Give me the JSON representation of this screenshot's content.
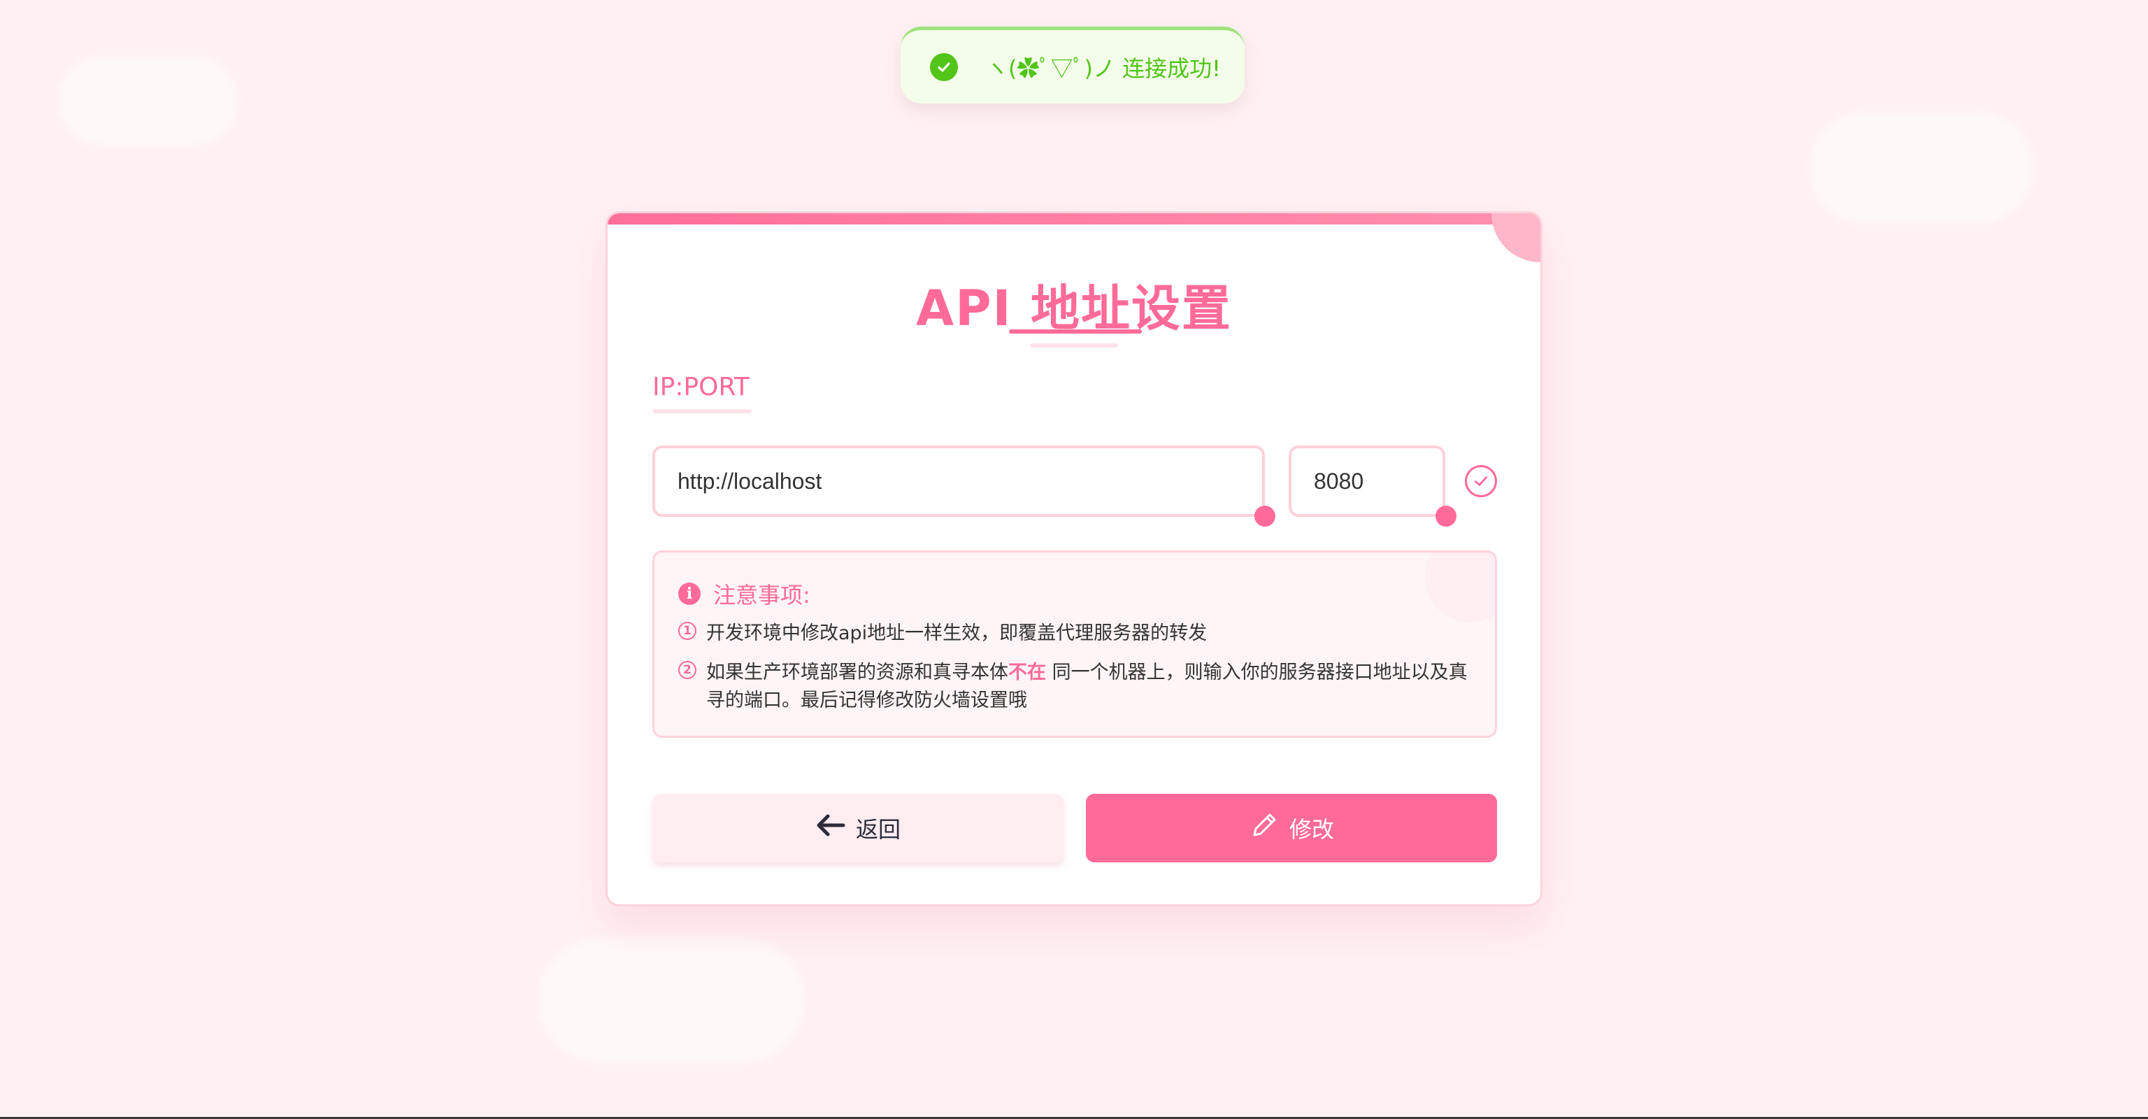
{
  "toast": {
    "icon": "check-circle-icon",
    "message": "ヽ(✿ﾟ▽ﾟ)ノ 连接成功!"
  },
  "card": {
    "title_prefix": "API ",
    "title_main": "地址设置",
    "section_label": "IP:PORT",
    "host_value": "http://localhost",
    "port_value": "8080",
    "verify_icon": "check-circle-outline-icon"
  },
  "notice": {
    "title": "注意事项:",
    "items": [
      {
        "num": "1",
        "text": "开发环境中修改api地址一样生效，即覆盖代理服务器的转发"
      },
      {
        "num": "2",
        "text_before": "如果生产环境部署的资源和真寻本体",
        "highlight": "不在",
        "text_after": " 同一个机器上，则输入你的服务器接口地址以及真寻的端口。最后记得修改防火墙设置哦"
      }
    ]
  },
  "buttons": {
    "back_label": "返回",
    "back_icon": "arrow-left-icon",
    "edit_label": "修改",
    "edit_icon": "pencil-icon"
  },
  "colors": {
    "accent": "#ff6b98",
    "success": "#52c41a",
    "background": "#fff1f3"
  }
}
